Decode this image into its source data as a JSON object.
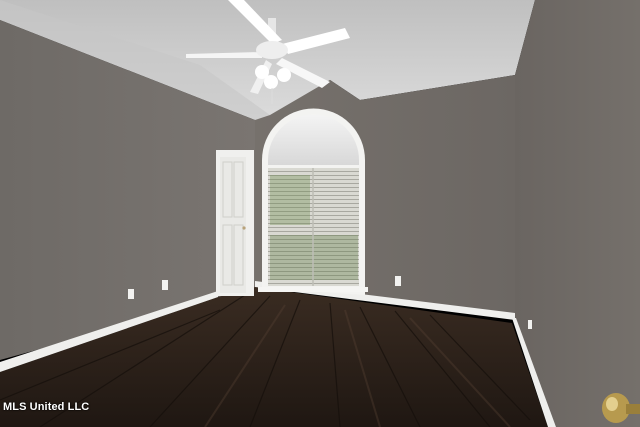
{
  "photo": {
    "watermark_text": "MLS United LLC",
    "colors": {
      "wall": "#706b66",
      "ceiling": "#cfcfcf",
      "floor": "#2a1f18",
      "trim": "#f2f2f0"
    }
  }
}
